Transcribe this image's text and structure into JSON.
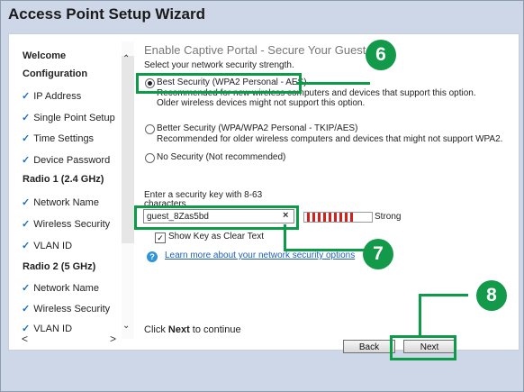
{
  "window": {
    "title": "Access Point Setup Wizard"
  },
  "sidebar": {
    "items": [
      {
        "label": "Welcome",
        "section": true,
        "checked": false
      },
      {
        "label": "Configuration",
        "section": true,
        "checked": false
      },
      {
        "label": "IP Address",
        "section": false,
        "checked": true
      },
      {
        "label": "Single Point Setup",
        "section": false,
        "checked": true
      },
      {
        "label": "Time Settings",
        "section": false,
        "checked": true
      },
      {
        "label": "Device Password",
        "section": false,
        "checked": true
      },
      {
        "label": "Radio 1 (2.4 GHz)",
        "section": true,
        "checked": false
      },
      {
        "label": "Network Name",
        "section": false,
        "checked": true
      },
      {
        "label": "Wireless Security",
        "section": false,
        "checked": true
      },
      {
        "label": "VLAN ID",
        "section": false,
        "checked": true
      },
      {
        "label": "Radio 2 (5 GHz)",
        "section": true,
        "checked": false
      },
      {
        "label": "Network Name",
        "section": false,
        "checked": true
      },
      {
        "label": "Wireless Security",
        "section": false,
        "checked": true
      },
      {
        "label": "VLAN ID",
        "section": false,
        "checked": true
      }
    ],
    "check_glyph": "✓"
  },
  "main": {
    "heading": "Enable Captive Portal - Secure Your Guest Ne",
    "instruction": "Select your network security strength.",
    "options": [
      {
        "label": "Best Security (WPA2 Personal - AES)",
        "desc1": "Recommended for new wireless computers and devices that support this option.",
        "desc2": "Older wireless devices might not support this option.",
        "selected": true
      },
      {
        "label": "Better Security (WPA/WPA2 Personal - TKIP/AES)",
        "desc1": "Recommended for older wireless computers and devices that might not support WPA2.",
        "selected": false
      },
      {
        "label": "No Security (Not recommended)",
        "selected": false
      }
    ],
    "key_prompt_1": "Enter a security key with 8-63",
    "key_prompt_2": "characters.",
    "key_value": "guest_8Zas5bd",
    "clear_glyph": "×",
    "strength_label": "Strong",
    "strength_level": "high",
    "show_key_label": "Show Key as Clear Text",
    "show_key_checked": true,
    "help_glyph": "?",
    "learn_more": "Learn more about your network security options",
    "continue_prefix": "Click ",
    "continue_bold": "Next",
    "continue_suffix": " to continue"
  },
  "buttons": {
    "back": "Back",
    "next": "Next"
  },
  "callouts": [
    "6",
    "7",
    "8"
  ],
  "colors": {
    "highlight": "#0c9b47",
    "callout": "#12994a",
    "strength": "#d3211e",
    "check": "#1b6fc1",
    "link": "#1f5fb7"
  }
}
